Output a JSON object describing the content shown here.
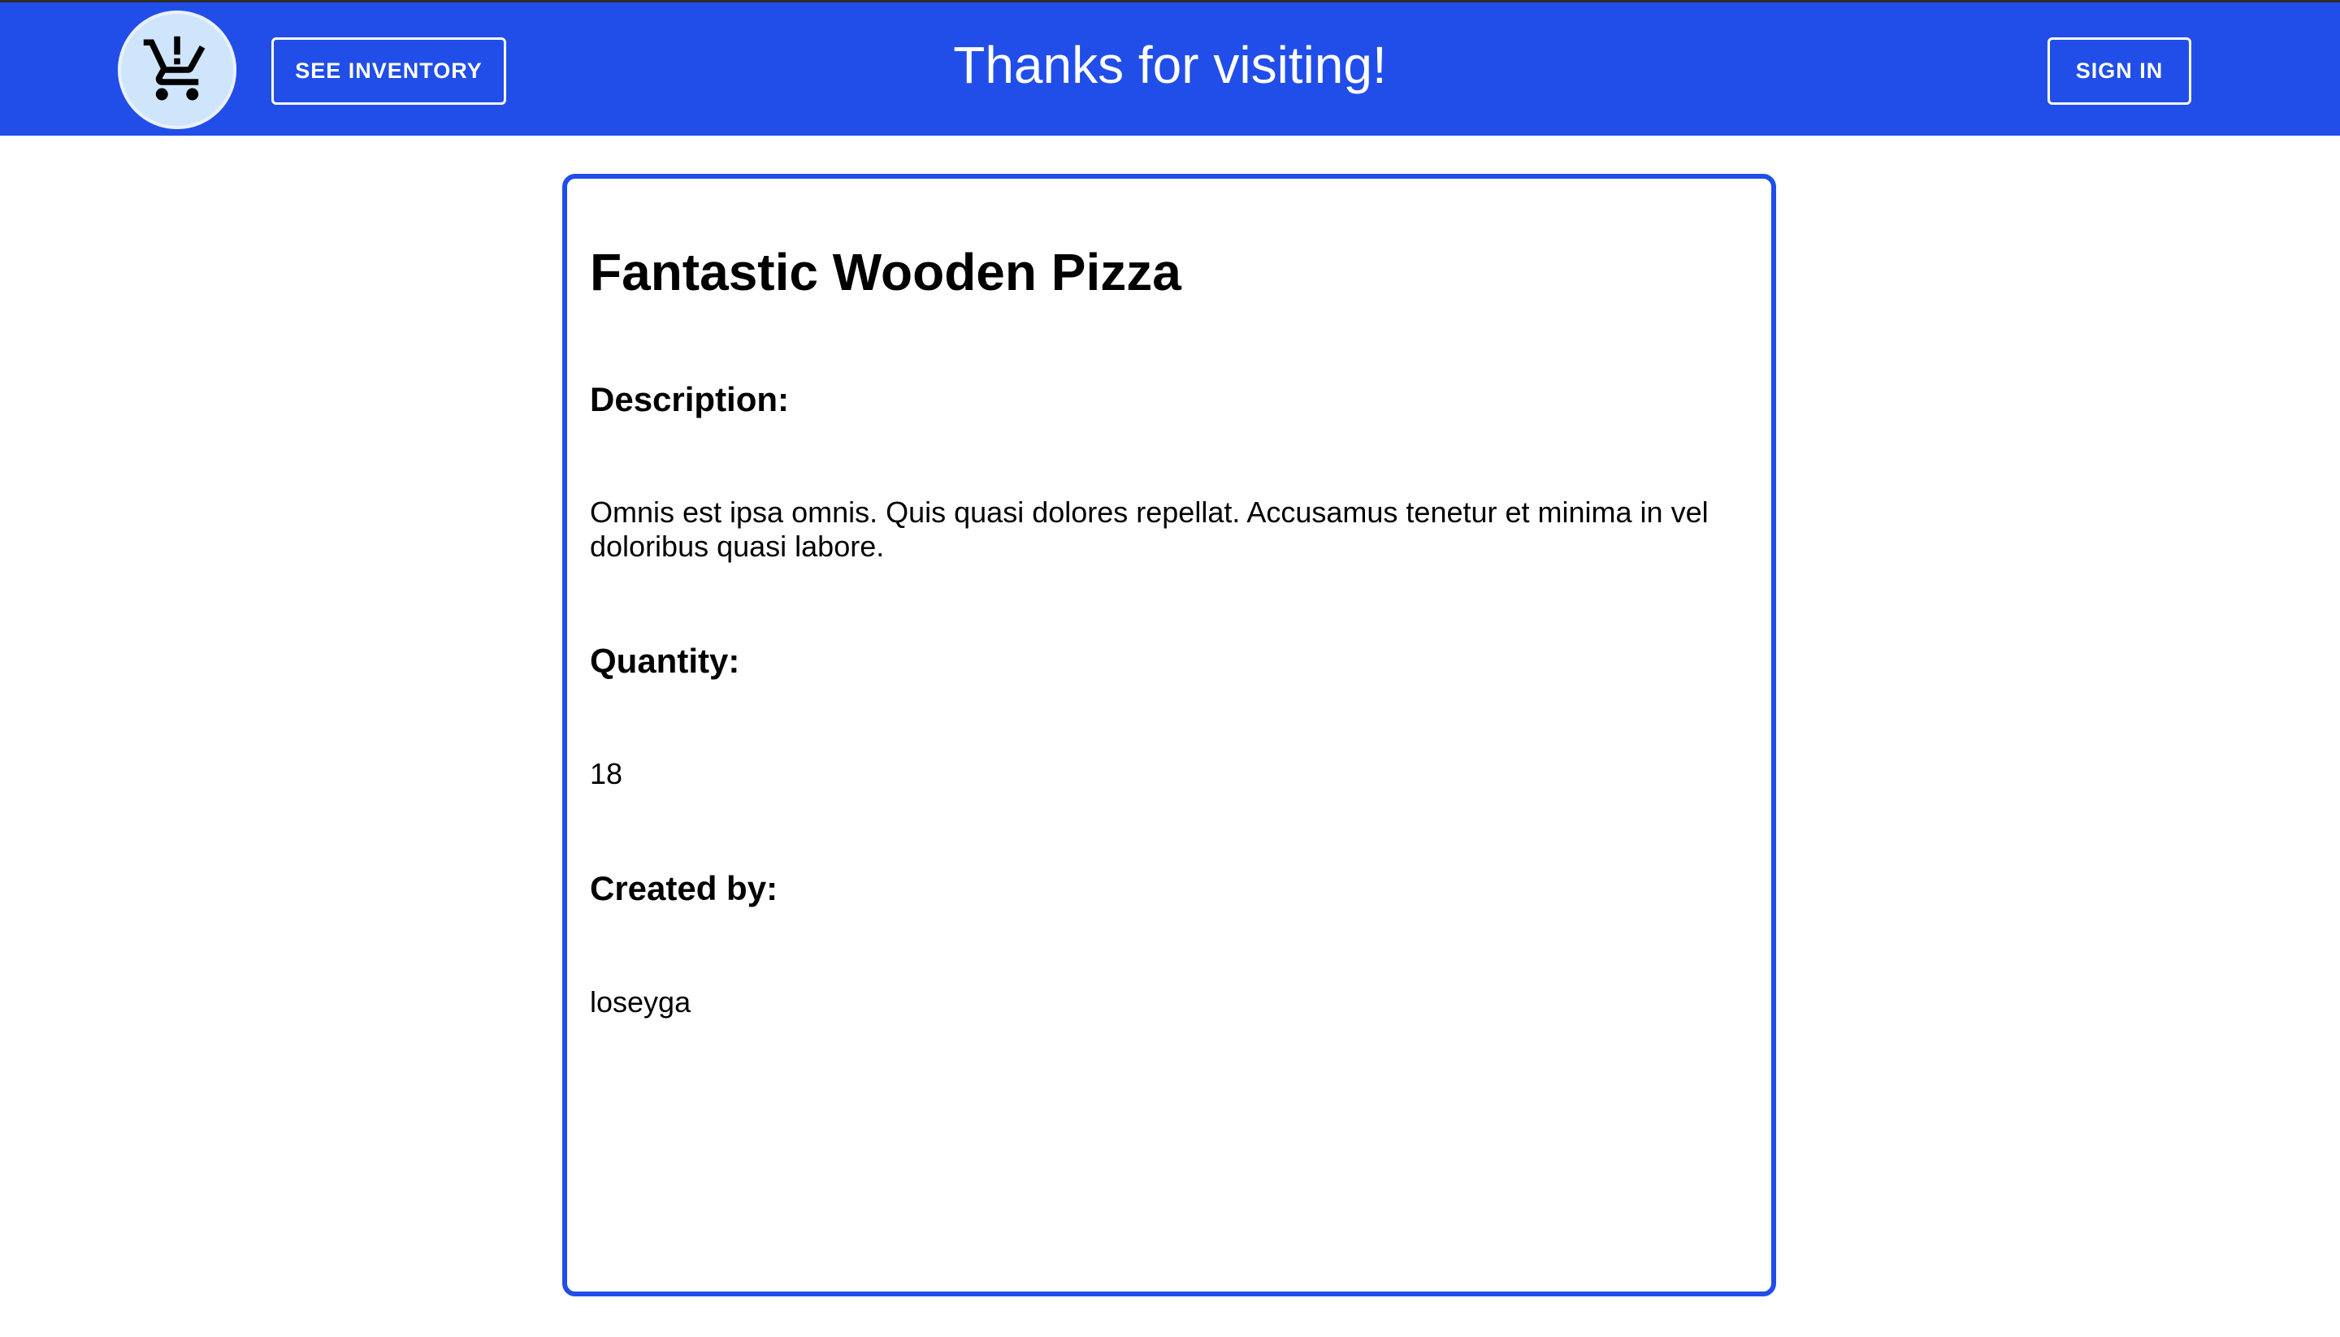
{
  "header": {
    "inventory_button": "SEE INVENTORY",
    "title": "Thanks for visiting!",
    "signin_button": "SIGN IN",
    "logo_icon": "cart-alert-icon",
    "bg_color": "#214ee9"
  },
  "item": {
    "title": "Fantastic Wooden Pizza",
    "description_label": "Description:",
    "description": "Omnis est ipsa omnis. Quis quasi dolores repellat. Accusamus tenetur et minima in vel doloribus quasi labore.",
    "quantity_label": "Quantity:",
    "quantity": "18",
    "created_by_label": "Created by:",
    "created_by": "loseyga"
  }
}
